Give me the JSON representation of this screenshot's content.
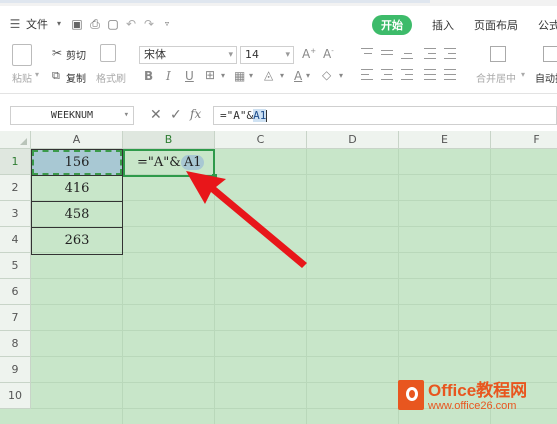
{
  "menu": {
    "file_label": "文件",
    "tabs": [
      {
        "label": "开始",
        "active": true
      },
      {
        "label": "插入",
        "active": false
      },
      {
        "label": "页面布局",
        "active": false
      },
      {
        "label": "公式",
        "active": false
      }
    ]
  },
  "ribbon": {
    "paste_label": "粘贴",
    "cut_label": "剪切",
    "copy_label": "复制",
    "format_painter_label": "格式刷",
    "font_name": "宋体",
    "font_size": "14",
    "merge_label": "合并居中",
    "autowrap_label": "自动换"
  },
  "formula_bar": {
    "name_box": "WEEKNUM",
    "formula_prefix": "=\"A\"&",
    "formula_ref": "A1"
  },
  "grid": {
    "columns": [
      "A",
      "B",
      "C",
      "D",
      "E",
      "F"
    ],
    "rows": [
      "1",
      "2",
      "3",
      "4",
      "5",
      "6",
      "7",
      "8",
      "9",
      "10"
    ],
    "selected_column": "B",
    "selected_row": "1",
    "column_a_values": [
      "156",
      "416",
      "458",
      "263"
    ],
    "b1_prefix": "=\"A\"&",
    "b1_ref": "A1"
  },
  "watermark": {
    "title": "Office教程网",
    "url": "www.office26.com"
  },
  "colors": {
    "accent": "#3dbb6a",
    "sheet_background": "#c8e6c9",
    "arrow": "#e8161a",
    "watermark": "#e8561f"
  }
}
